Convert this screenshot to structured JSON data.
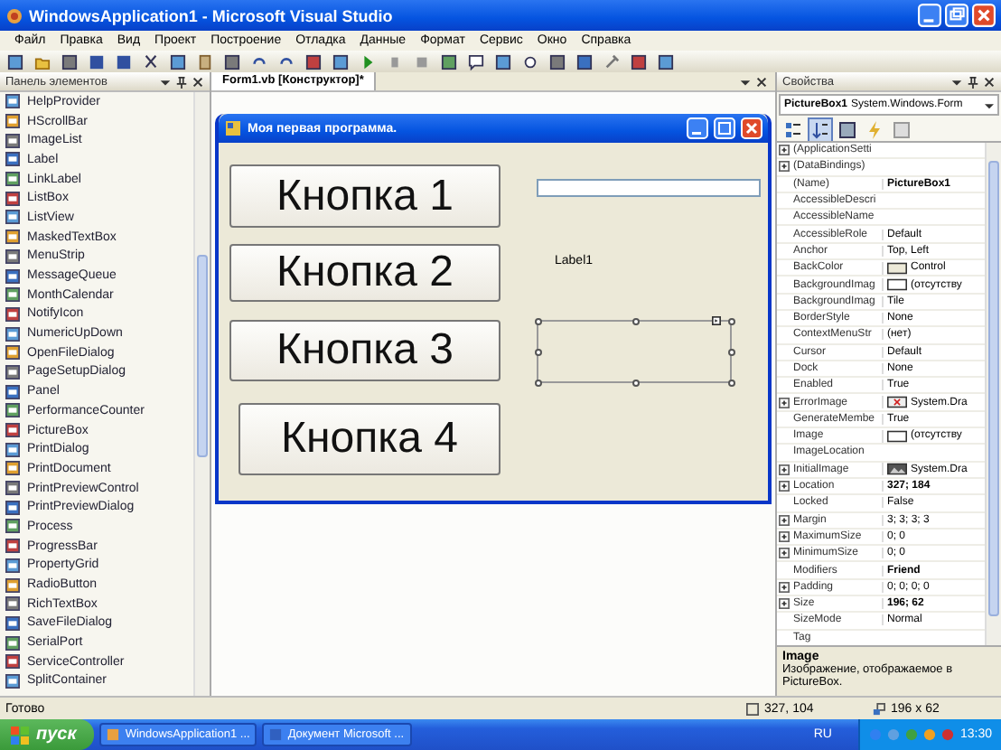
{
  "window": {
    "title": "WindowsApplication1 - Microsoft Visual Studio"
  },
  "menu": [
    "Файл",
    "Правка",
    "Вид",
    "Проект",
    "Построение",
    "Отладка",
    "Данные",
    "Формат",
    "Сервис",
    "Окно",
    "Справка"
  ],
  "toolbox": {
    "title": "Панель элементов",
    "items": [
      "HelpProvider",
      "HScrollBar",
      "ImageList",
      "Label",
      "LinkLabel",
      "ListBox",
      "ListView",
      "MaskedTextBox",
      "MenuStrip",
      "MessageQueue",
      "MonthCalendar",
      "NotifyIcon",
      "NumericUpDown",
      "OpenFileDialog",
      "PageSetupDialog",
      "Panel",
      "PerformanceCounter",
      "PictureBox",
      "PrintDialog",
      "PrintDocument",
      "PrintPreviewControl",
      "PrintPreviewDialog",
      "Process",
      "ProgressBar",
      "PropertyGrid",
      "RadioButton",
      "RichTextBox",
      "SaveFileDialog",
      "SerialPort",
      "ServiceController",
      "SplitContainer"
    ]
  },
  "designer": {
    "tab": "Form1.vb [Конструктор]*",
    "form": {
      "title": "Моя первая программа.",
      "buttons": [
        "Кнопка 1",
        "Кнопка 2",
        "Кнопка 3",
        "Кнопка 4"
      ],
      "label": "Label1",
      "picturebox": {
        "selected": true
      }
    }
  },
  "properties": {
    "title": "Свойства",
    "object": "PictureBox1",
    "type": "System.Windows.Form",
    "rows": [
      {
        "name": "(ApplicationSetti",
        "expandable": true
      },
      {
        "name": "(DataBindings)",
        "expandable": true
      },
      {
        "name": "(Name)",
        "value": "PictureBox1",
        "expandable": false,
        "bold": true
      },
      {
        "name": "AccessibleDescri",
        "expandable": false
      },
      {
        "name": "AccessibleName",
        "expandable": false
      },
      {
        "name": "AccessibleRole",
        "value": "Default",
        "expandable": false,
        "bold": false
      },
      {
        "name": "Anchor",
        "value": "Top, Left",
        "expandable": false,
        "bold": false
      },
      {
        "name": "BackColor",
        "value": "Control",
        "expandable": false,
        "bold": false,
        "kind": "color"
      },
      {
        "name": "BackgroundImag",
        "value": "(отсутству",
        "expandable": false,
        "bold": false,
        "kind": "empty"
      },
      {
        "name": "BackgroundImag",
        "value": "Tile",
        "expandable": false,
        "bold": false
      },
      {
        "name": "BorderStyle",
        "value": "None",
        "expandable": false,
        "bold": false
      },
      {
        "name": "ContextMenuStr",
        "value": "(нет)",
        "expandable": false,
        "bold": false
      },
      {
        "name": "Cursor",
        "value": "Default",
        "expandable": false,
        "bold": false
      },
      {
        "name": "Dock",
        "value": "None",
        "expandable": false,
        "bold": false
      },
      {
        "name": "Enabled",
        "value": "True",
        "expandable": false,
        "bold": false
      },
      {
        "name": "ErrorImage",
        "value": "System.Dra",
        "expandable": true,
        "bold": false,
        "kind": "error"
      },
      {
        "name": "GenerateMembe",
        "value": "True",
        "expandable": false,
        "bold": false
      },
      {
        "name": "Image",
        "value": "(отсутству",
        "expandable": false,
        "bold": false,
        "kind": "empty"
      },
      {
        "name": "ImageLocation",
        "expandable": false
      },
      {
        "name": "InitialImage",
        "value": "System.Dra",
        "expandable": true,
        "bold": false,
        "kind": "image"
      },
      {
        "name": "Location",
        "value": "327; 184",
        "expandable": true,
        "bold": true
      },
      {
        "name": "Locked",
        "value": "False",
        "expandable": false,
        "bold": false
      },
      {
        "name": "Margin",
        "value": "3; 3; 3; 3",
        "expandable": true,
        "bold": false
      },
      {
        "name": "MaximumSize",
        "value": "0; 0",
        "expandable": true,
        "bold": false
      },
      {
        "name": "MinimumSize",
        "value": "0; 0",
        "expandable": true,
        "bold": false
      },
      {
        "name": "Modifiers",
        "value": "Friend",
        "expandable": false,
        "bold": true
      },
      {
        "name": "Padding",
        "value": "0; 0; 0; 0",
        "expandable": true,
        "bold": false
      },
      {
        "name": "Size",
        "value": "196; 62",
        "expandable": true,
        "bold": true
      },
      {
        "name": "SizeMode",
        "value": "Normal",
        "expandable": false,
        "bold": false
      },
      {
        "name": "Tag",
        "expandable": false
      }
    ],
    "description": {
      "title": "Image",
      "text": "Изображение, отображаемое в PictureBox."
    }
  },
  "status_bar": {
    "text": "Готово",
    "location": "327, 104",
    "size": "196 x 62"
  },
  "taskbar": {
    "start": "пуск",
    "tasks": [
      "WindowsApplication1 ...",
      "Документ Microsoft ..."
    ],
    "language": "RU",
    "clock": "13:30"
  }
}
